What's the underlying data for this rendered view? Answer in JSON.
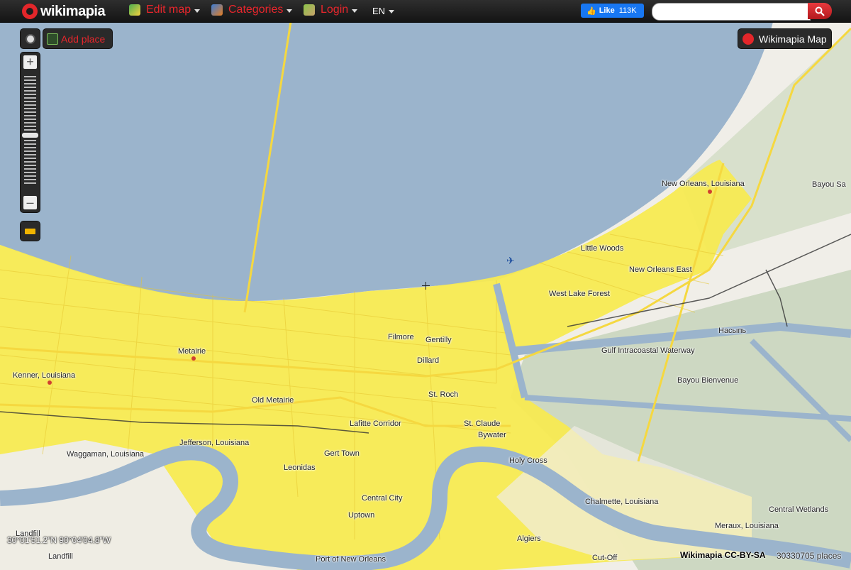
{
  "topbar": {
    "logo_text": "wikimapia",
    "edit_map_label": "Edit map",
    "categories_label": "Categories",
    "login_label": "Login",
    "language": "EN",
    "fb_like_label": "Like",
    "fb_like_count": "113K",
    "search_placeholder": ""
  },
  "controls": {
    "add_place_label": "Add place",
    "map_type_label": "Wikimapia Map"
  },
  "map_labels": [
    {
      "text": "New Orleans, Louisiana"
    },
    {
      "text": "Bayou Sa"
    },
    {
      "text": "Little Woods"
    },
    {
      "text": "New Orleans East"
    },
    {
      "text": "West Lake Forest"
    },
    {
      "text": "Насыпь"
    },
    {
      "text": "Gulf Intracoastal Waterway"
    },
    {
      "text": "Bayou Bienvenue"
    },
    {
      "text": "Filmore"
    },
    {
      "text": "Gentilly"
    },
    {
      "text": "Dillard"
    },
    {
      "text": "Metairie"
    },
    {
      "text": "Kenner, Louisiana"
    },
    {
      "text": "St. Roch"
    },
    {
      "text": "Old Metairie"
    },
    {
      "text": "Lafitte Corridor"
    },
    {
      "text": "St. Claude"
    },
    {
      "text": "Bywater"
    },
    {
      "text": "Jefferson, Louisiana"
    },
    {
      "text": "Waggaman, Louisiana"
    },
    {
      "text": "Gert Town"
    },
    {
      "text": "Holy Cross"
    },
    {
      "text": "Leonidas"
    },
    {
      "text": "Central City"
    },
    {
      "text": "Chalmette, Louisiana"
    },
    {
      "text": "Central Wetlands"
    },
    {
      "text": "Uptown"
    },
    {
      "text": "Meraux, Louisiana"
    },
    {
      "text": "Landfill"
    },
    {
      "text": "Landfill"
    },
    {
      "text": "Algiers"
    },
    {
      "text": "Cut-Off"
    },
    {
      "text": "Port of New Orleans"
    }
  ],
  "footer": {
    "coordinates": "30°01'51.2\"N 90°04'04.8\"W",
    "license": "Wikimapia CC-BY-SA",
    "places_count": "30330705 places"
  },
  "colors": {
    "water": "#9bb4cc",
    "urban": "#f7ea52",
    "road": "#f5d840",
    "land": "#f0eee8",
    "wetland": "#cdd8c2",
    "accent": "#e3262a"
  },
  "icons": [
    "location-icon",
    "add-place-icon",
    "wikimapia-logo-icon",
    "ruler-icon",
    "search-icon",
    "airport-icon"
  ]
}
